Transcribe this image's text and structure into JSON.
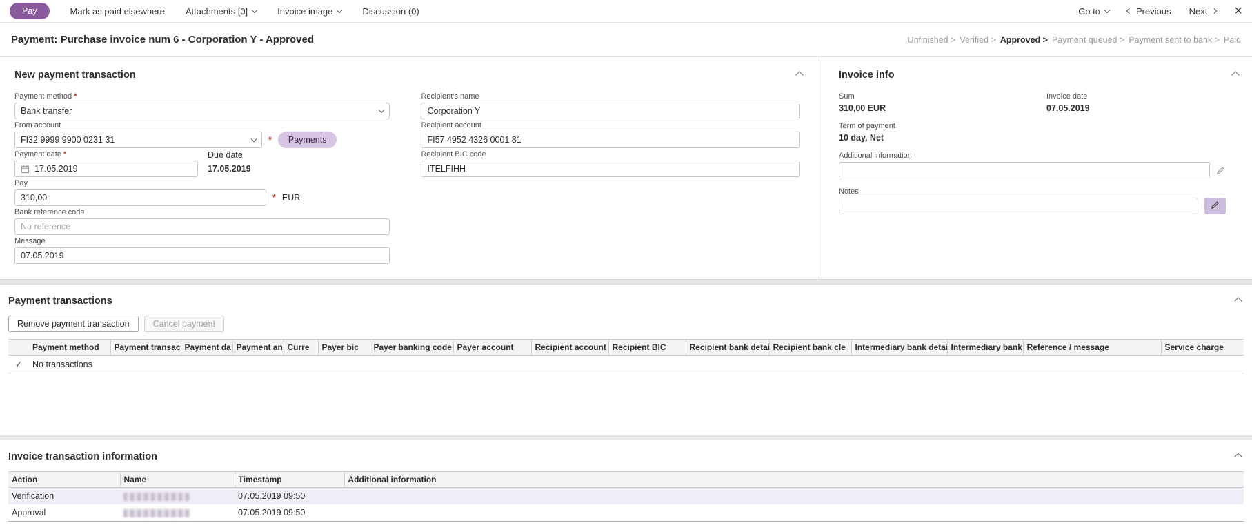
{
  "icons": {
    "close_glyph": "×",
    "check_glyph": "✓"
  },
  "toolbar": {
    "pay_label": "Pay",
    "mark_paid_label": "Mark as paid elsewhere",
    "attachments_label": "Attachments [0]",
    "invoice_image_label": "Invoice image",
    "discussion_label": "Discussion (0)",
    "goto_label": "Go to",
    "previous_label": "Previous",
    "next_label": "Next"
  },
  "header": {
    "title": "Payment: Purchase invoice num 6 - Corporation Y - Approved",
    "statuses": [
      "Unfinished >",
      "Verified >",
      "Approved >",
      "Payment queued >",
      "Payment sent to bank >",
      "Paid"
    ],
    "active_status": "Approved >"
  },
  "new_payment": {
    "title": "New payment transaction",
    "required_marker": "*",
    "payment_method_label": "Payment method",
    "payment_method_value": "Bank transfer",
    "from_account_label": "From account",
    "from_account_value": "FI32 9999 9900 0231 31",
    "payments_button_label": "Payments",
    "payment_date_label": "Payment date",
    "payment_date_value": "17.05.2019",
    "due_date_label": "Due date",
    "due_date_value": "17.05.2019",
    "pay_label": "Pay",
    "pay_value": "310,00",
    "pay_currency": "EUR",
    "bank_reference_label": "Bank reference code",
    "bank_reference_placeholder": "No reference",
    "message_label": "Message",
    "message_value": "07.05.2019",
    "recipient_name_label": "Recipient's name",
    "recipient_name_value": "Corporation Y",
    "recipient_account_label": "Recipient account",
    "recipient_account_value": "FI57 4952 4326 0001 81",
    "recipient_bic_label": "Recipient BIC code",
    "recipient_bic_value": "ITELFIHH"
  },
  "invoice_info": {
    "title": "Invoice info",
    "sum_label": "Sum",
    "sum_value": "310,00 EUR",
    "invoice_date_label": "Invoice date",
    "invoice_date_value": "07.05.2019",
    "term_label": "Term of payment",
    "term_value": "10 day, Net",
    "additional_info_label": "Additional information",
    "notes_label": "Notes"
  },
  "payment_transactions": {
    "title": "Payment transactions",
    "remove_button_label": "Remove payment transaction",
    "cancel_button_label": "Cancel payment",
    "columns": [
      "Payment method",
      "Payment transacti",
      "Payment da",
      "Payment an",
      "Curre",
      "Payer bic",
      "Payer banking code",
      "Payer account",
      "Recipient account",
      "Recipient BIC",
      "Recipient bank details",
      "Recipient bank cle",
      "Intermediary bank details",
      "Intermediary bank",
      "Reference / message",
      "Service charge"
    ],
    "empty_text": "No transactions"
  },
  "invoice_transactions": {
    "title": "Invoice transaction information",
    "columns": [
      "Action",
      "Name",
      "Timestamp",
      "Additional information"
    ],
    "rows": [
      {
        "action": "Verification",
        "timestamp": "07.05.2019 09:50",
        "additional": ""
      },
      {
        "action": "Approval",
        "timestamp": "07.05.2019 09:50",
        "additional": ""
      }
    ]
  }
}
